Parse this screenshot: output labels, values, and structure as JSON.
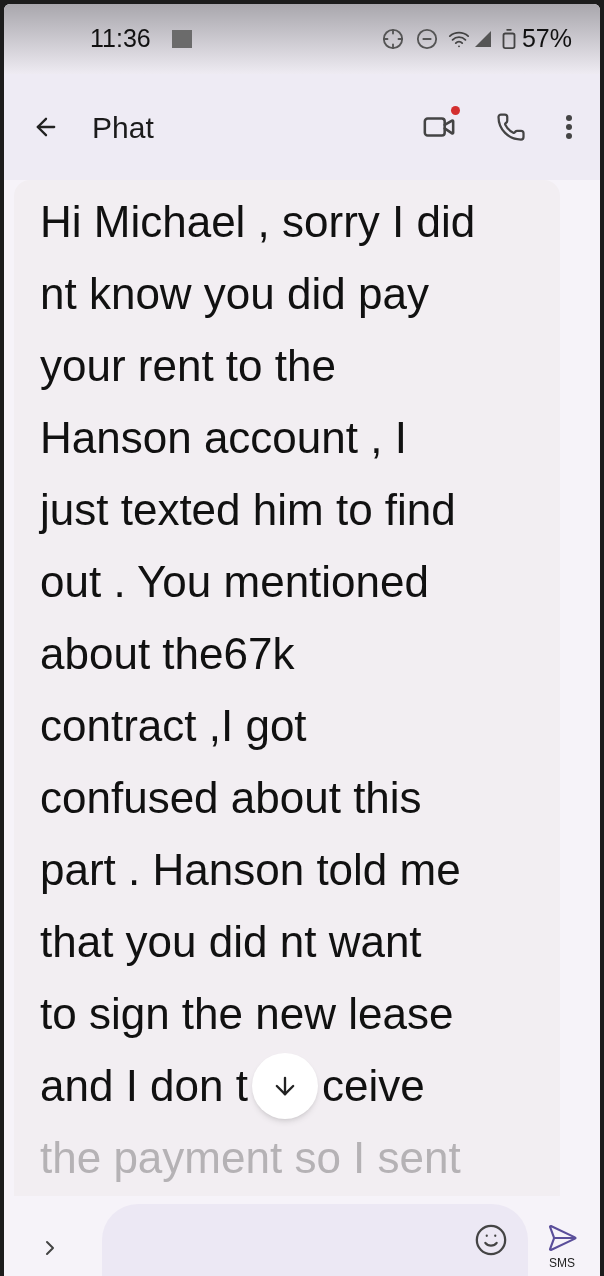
{
  "status_bar": {
    "time": "11:36",
    "battery": "57%"
  },
  "header": {
    "title": "Phat",
    "video_call_badge": true
  },
  "message": {
    "lines": [
      "Hi Michael , sorry I did",
      "nt know you did pay",
      "your rent to the",
      "Hanson account , I",
      "just texted him to find",
      "out . You mentioned",
      "about the67k",
      "contract ,I got",
      "confused about this",
      "part . Hanson told me",
      "that you did nt want",
      "to sign the new lease"
    ],
    "covered_line": {
      "before": "and I don t",
      "after": "ceive"
    },
    "last_line": "the payment so I sent"
  },
  "composer": {
    "send_label": "SMS"
  }
}
